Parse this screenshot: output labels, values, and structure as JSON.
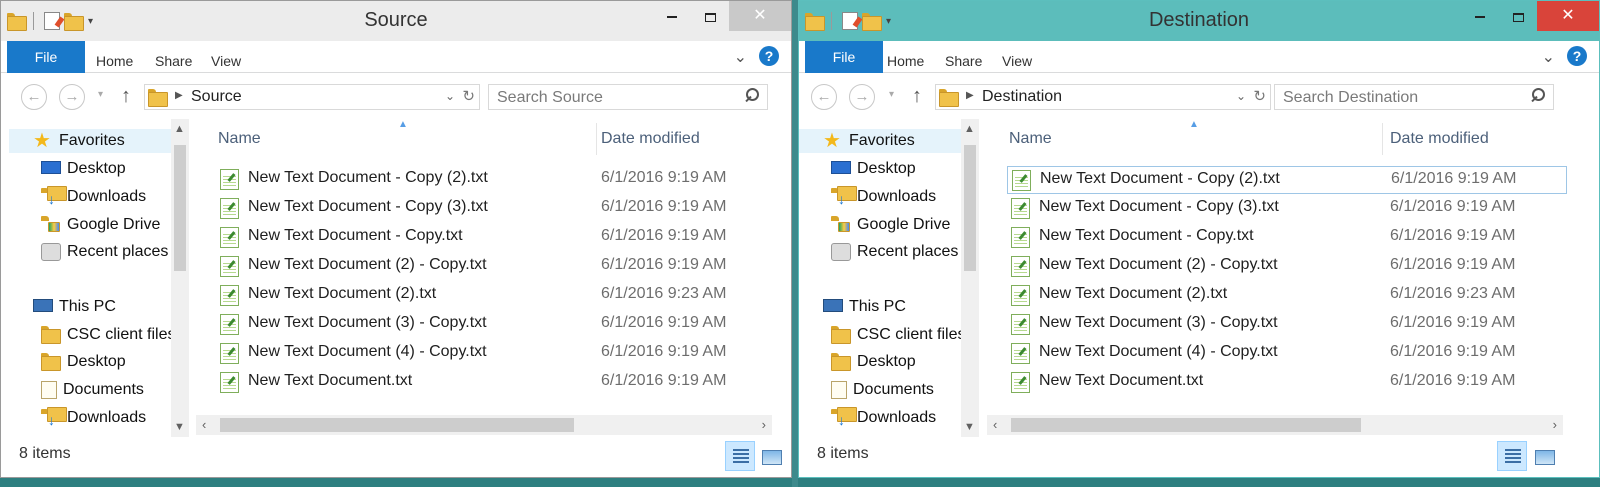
{
  "windows": [
    {
      "id": "source",
      "title": "Source",
      "ribbon": {
        "file": "File",
        "tabs": [
          "Home",
          "Share",
          "View"
        ],
        "help": "?"
      },
      "address": {
        "crumb": "Source",
        "search_placeholder": "Search Source"
      },
      "nav": {
        "favorites": "Favorites",
        "fav_items": [
          "Desktop",
          "Downloads",
          "Google Drive",
          "Recent places"
        ],
        "this_pc": "This PC",
        "pc_items": [
          "CSC client files",
          "Desktop",
          "Documents",
          "Downloads"
        ]
      },
      "columns": {
        "name": "Name",
        "date": "Date modified"
      },
      "files": [
        {
          "name": "New Text Document - Copy (2).txt",
          "date": "6/1/2016 9:19 AM"
        },
        {
          "name": "New Text Document - Copy (3).txt",
          "date": "6/1/2016 9:19 AM"
        },
        {
          "name": "New Text Document - Copy.txt",
          "date": "6/1/2016 9:19 AM"
        },
        {
          "name": "New Text Document (2) - Copy.txt",
          "date": "6/1/2016 9:19 AM"
        },
        {
          "name": "New Text Document (2).txt",
          "date": "6/1/2016 9:23 AM"
        },
        {
          "name": "New Text Document (3) - Copy.txt",
          "date": "6/1/2016 9:19 AM"
        },
        {
          "name": "New Text Document (4) - Copy.txt",
          "date": "6/1/2016 9:19 AM"
        },
        {
          "name": "New Text Document.txt",
          "date": "6/1/2016 9:19 AM"
        }
      ],
      "status": "8 items"
    },
    {
      "id": "destination",
      "title": "Destination",
      "ribbon": {
        "file": "File",
        "tabs": [
          "Home",
          "Share",
          "View"
        ],
        "help": "?"
      },
      "address": {
        "crumb": "Destination",
        "search_placeholder": "Search Destination"
      },
      "nav": {
        "favorites": "Favorites",
        "fav_items": [
          "Desktop",
          "Downloads",
          "Google Drive",
          "Recent places"
        ],
        "this_pc": "This PC",
        "pc_items": [
          "CSC client files",
          "Desktop",
          "Documents",
          "Downloads"
        ]
      },
      "columns": {
        "name": "Name",
        "date": "Date modified"
      },
      "files": [
        {
          "name": "New Text Document - Copy (2).txt",
          "date": "6/1/2016 9:19 AM"
        },
        {
          "name": "New Text Document - Copy (3).txt",
          "date": "6/1/2016 9:19 AM"
        },
        {
          "name": "New Text Document - Copy.txt",
          "date": "6/1/2016 9:19 AM"
        },
        {
          "name": "New Text Document (2) - Copy.txt",
          "date": "6/1/2016 9:19 AM"
        },
        {
          "name": "New Text Document (2).txt",
          "date": "6/1/2016 9:23 AM"
        },
        {
          "name": "New Text Document (3) - Copy.txt",
          "date": "6/1/2016 9:19 AM"
        },
        {
          "name": "New Text Document (4) - Copy.txt",
          "date": "6/1/2016 9:19 AM"
        },
        {
          "name": "New Text Document.txt",
          "date": "6/1/2016 9:19 AM"
        }
      ],
      "status": "8 items"
    }
  ],
  "icons": {
    "title_controls": [
      "minimize-icon",
      "maximize-icon",
      "close-icon"
    ],
    "nav_buttons": [
      "back-arrow-icon",
      "forward-arrow-icon",
      "up-arrow-icon"
    ]
  },
  "colors": {
    "file_tab": "#1979ca",
    "dest_frame": "#5cbdbb",
    "dest_close": "#d9443a"
  }
}
